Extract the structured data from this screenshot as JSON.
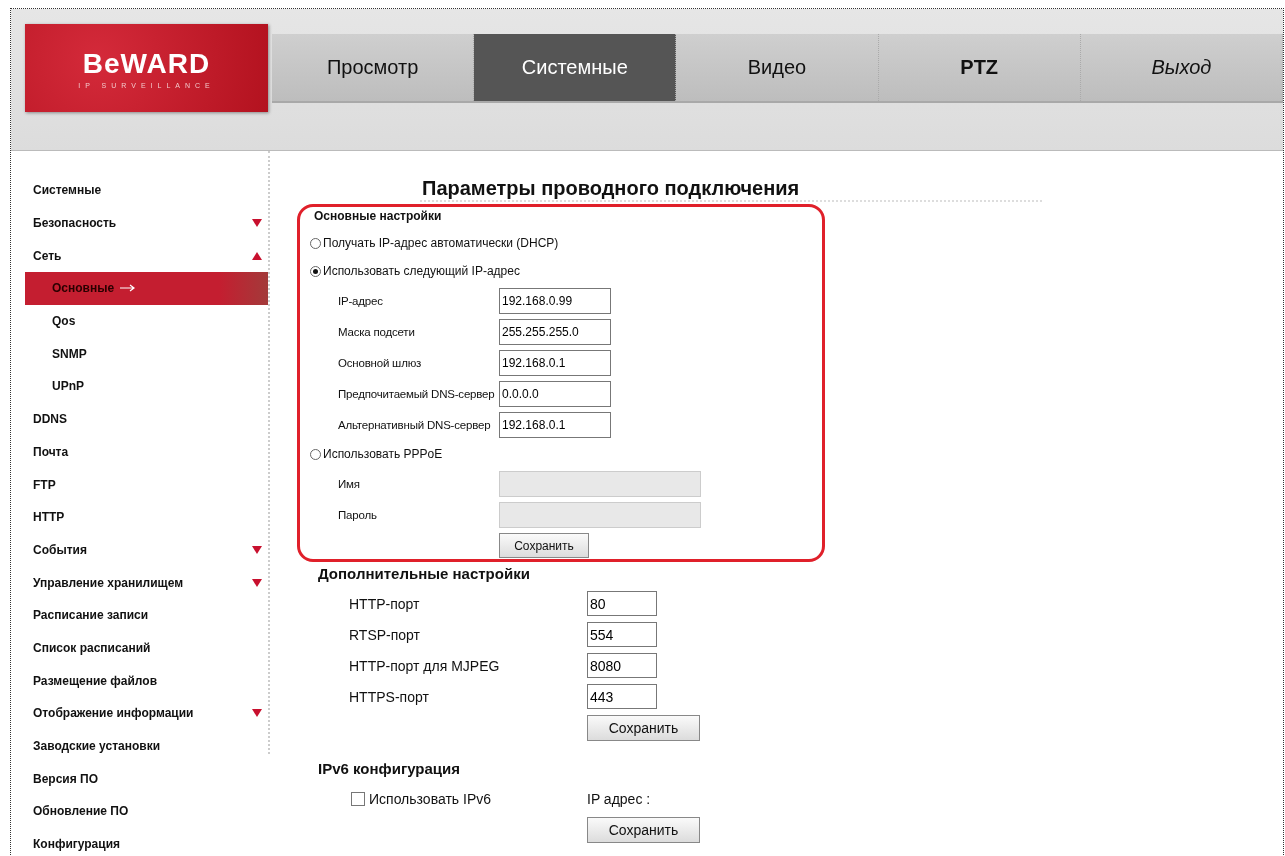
{
  "header": {
    "logo": {
      "brand": "BeWARD",
      "tagline": "IP SURVEILLANCE"
    },
    "tabs": [
      {
        "label": "Просмотр",
        "selected": false,
        "kind": "normal"
      },
      {
        "label": "Системные",
        "selected": true,
        "kind": "normal"
      },
      {
        "label": "Видео",
        "selected": false,
        "kind": "normal"
      },
      {
        "label": "PTZ",
        "selected": false,
        "kind": "bold"
      },
      {
        "label": "Выход",
        "selected": false,
        "kind": "italic"
      }
    ]
  },
  "sidebar": {
    "items": [
      {
        "label": "Системные",
        "selected": false
      },
      {
        "label": "Безопасность",
        "selected": false,
        "expanded": false
      },
      {
        "label": "Сеть",
        "selected": false,
        "expanded": true,
        "children": [
          {
            "label": "Основные",
            "selected": true
          },
          {
            "label": "Qos",
            "selected": false
          },
          {
            "label": "SNMP",
            "selected": false
          },
          {
            "label": "UPnP",
            "selected": false
          }
        ]
      },
      {
        "label": "DDNS",
        "selected": false
      },
      {
        "label": "Почта",
        "selected": false
      },
      {
        "label": "FTP",
        "selected": false
      },
      {
        "label": "HTTP",
        "selected": false
      },
      {
        "label": "События",
        "selected": false,
        "expanded": false
      },
      {
        "label": "Управление хранилищем",
        "selected": false,
        "expanded": false
      },
      {
        "label": "Расписание записи",
        "selected": false
      },
      {
        "label": "Список расписаний",
        "selected": false
      },
      {
        "label": "Размещение файлов",
        "selected": false
      },
      {
        "label": "Отображение информации",
        "selected": false,
        "expanded": false
      },
      {
        "label": "Заводские установки",
        "selected": false
      },
      {
        "label": "Версия ПО",
        "selected": false
      },
      {
        "label": "Обновление ПО",
        "selected": false
      },
      {
        "label": "Конфигурация",
        "selected": false
      }
    ]
  },
  "page_title": "Параметры проводного подключения",
  "basic": {
    "title": "Основные настройки",
    "modes": [
      {
        "label": "Получать IP-адрес автоматически (DHCP)",
        "selected": false
      },
      {
        "label": "Использовать следующий IP-адрес",
        "selected": true,
        "fields": [
          {
            "label": "IP-адрес",
            "value": "192.168.0.99",
            "disabled": false
          },
          {
            "label": "Маска подсети",
            "value": "255.255.255.0",
            "disabled": false
          },
          {
            "label": "Основной шлюз",
            "value": "192.168.0.1",
            "disabled": false
          },
          {
            "label": "Предпочитаемый DNS-сервер",
            "value": "0.0.0.0",
            "disabled": false
          },
          {
            "label": "Альтернативный DNS-сервер",
            "value": "192.168.0.1",
            "disabled": false
          }
        ]
      },
      {
        "label": "Использовать PPPoE",
        "selected": false,
        "fields": [
          {
            "label": "Имя",
            "disabled": true
          },
          {
            "label": "Пароль",
            "disabled": true
          }
        ]
      }
    ],
    "button": "Сохранить"
  },
  "additional": {
    "title": "Дополнительные настройки",
    "fields": [
      {
        "label": "HTTP-порт",
        "value": "80"
      },
      {
        "label": "RTSP-порт",
        "value": "554"
      },
      {
        "label": "HTTP-порт для MJPEG",
        "value": "8080"
      },
      {
        "label": "HTTPS-порт",
        "value": "443"
      }
    ],
    "button": "Сохранить"
  },
  "ipv6": {
    "title": "IPv6 конфигурация",
    "checkbox": {
      "label": "Использовать IPv6",
      "checked": false
    },
    "ip_label": "IP адрес :",
    "button": "Сохранить"
  }
}
